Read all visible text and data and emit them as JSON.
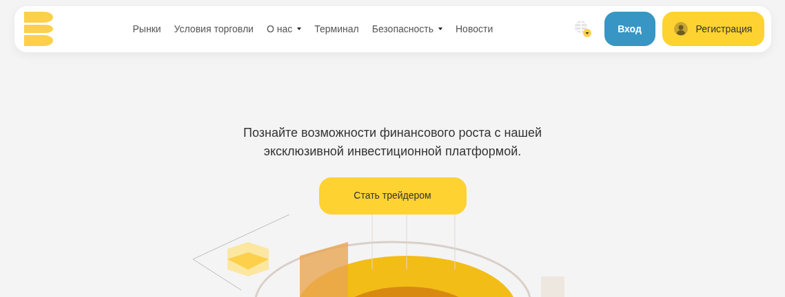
{
  "nav": {
    "items": [
      {
        "label": "Рынки",
        "dropdown": false
      },
      {
        "label": "Условия торговли",
        "dropdown": false
      },
      {
        "label": "О нас",
        "dropdown": true
      },
      {
        "label": "Терминал",
        "dropdown": false
      },
      {
        "label": "Безопасность",
        "dropdown": true
      },
      {
        "label": "Новости",
        "dropdown": false
      }
    ],
    "login": "Вход",
    "register": "Регистрация"
  },
  "hero": {
    "headline": "Познайте возможности финансового роста с нашей эксклюзивной инвестиционной платформой.",
    "cta": "Стать трейдером"
  }
}
